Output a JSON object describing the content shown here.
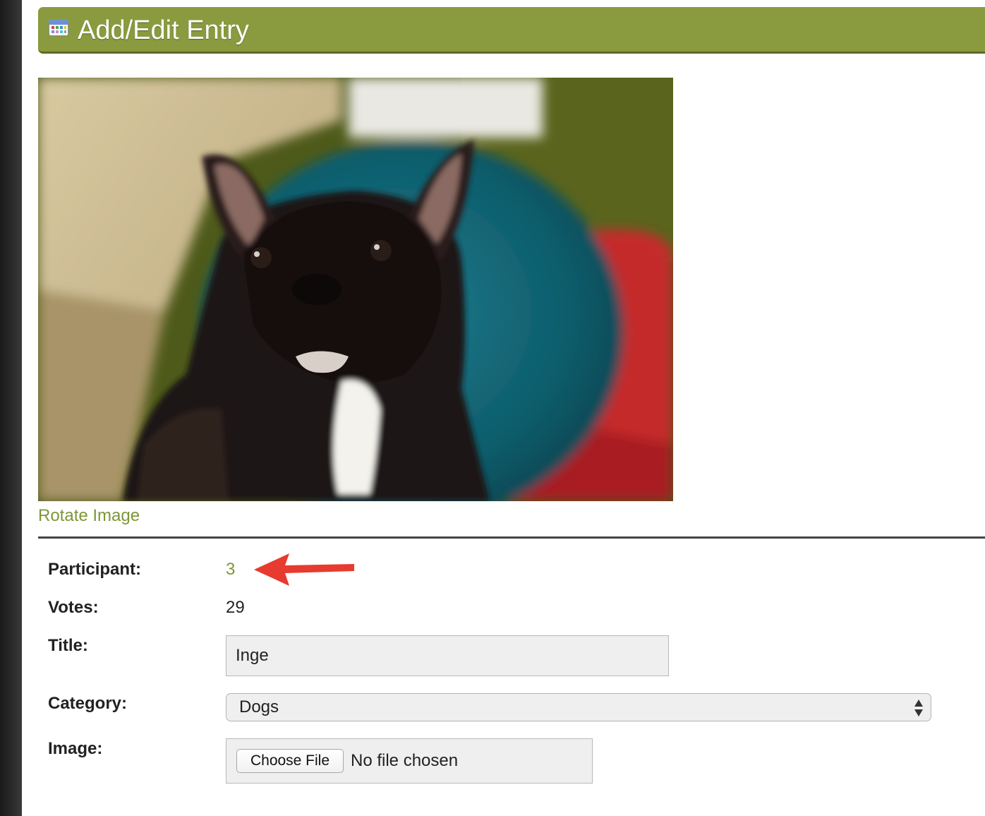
{
  "header": {
    "title": "Add/Edit Entry",
    "icon": "calendar-icon"
  },
  "image": {
    "alt": "Photo of a black French bulldog sitting on a teal cushion"
  },
  "rotate_link": "Rotate Image",
  "fields": {
    "participant": {
      "label": "Participant:",
      "value": "3"
    },
    "votes": {
      "label": "Votes:",
      "value": "29"
    },
    "title": {
      "label": "Title:",
      "value": "Inge"
    },
    "category": {
      "label": "Category:",
      "selected": "Dogs"
    },
    "image": {
      "label": "Image:",
      "button": "Choose File",
      "status": "No file chosen"
    }
  },
  "colors": {
    "header_bg": "#8a9a3e",
    "link": "#7d9638",
    "annotation_arrow": "#e63b2e"
  }
}
